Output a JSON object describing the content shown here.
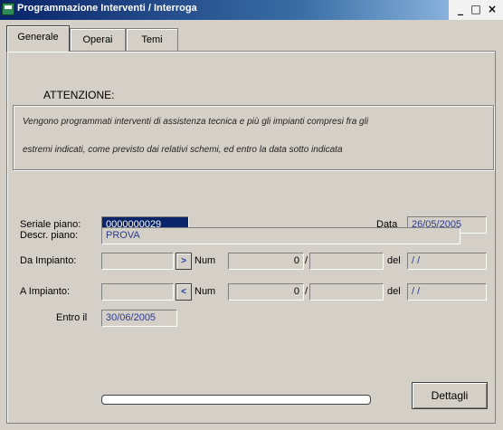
{
  "window": {
    "title": "Programmazione Interventi / Interroga",
    "controls": {
      "minimize": "_",
      "maximize": "□",
      "close": "×"
    }
  },
  "tabs": [
    {
      "label": "Generale",
      "active": true
    },
    {
      "label": "Operai",
      "active": false
    },
    {
      "label": "Temi",
      "active": false
    }
  ],
  "attention": {
    "title": "ATTENZIONE:",
    "line1": "Vengono programmati interventi di assistenza tecnica e più gli impianti compresi fra gli",
    "line2": "estremi indicati, come previsto dai relativi schemi, ed entro la data sotto indicata"
  },
  "form": {
    "seriale_label": "Seriale piano:",
    "seriale_value": "0000000029",
    "data_label": "Data",
    "data_value": "26/05/2005",
    "descr_label": "Descr. piano:",
    "descr_value": "PROVA",
    "da_impianto_label": "Da Impianto:",
    "da_impianto_value": "",
    "da_btn": ">",
    "num_label_1": "Num",
    "da_num_value": "0",
    "sep_1": "/",
    "del_label_1": "del",
    "da_del_value": "/ /",
    "a_impianto_label": "A Impianto:",
    "a_impianto_value": "",
    "a_btn": "<",
    "num_label_2": "Num",
    "a_num_value": "0",
    "sep_2": "/",
    "del_label_2": "del",
    "a_del_value": "/ /",
    "entro_label": "Entro il",
    "entro_value": "30/06/2005"
  },
  "progress": {
    "value": 0
  },
  "buttons": {
    "dettagli": "Dettagli"
  },
  "colors": {
    "titlebar": "#0a246a",
    "face": "#d4d0c8",
    "selection": "#0a246a"
  },
  "icons": {
    "app": "app-icon"
  }
}
